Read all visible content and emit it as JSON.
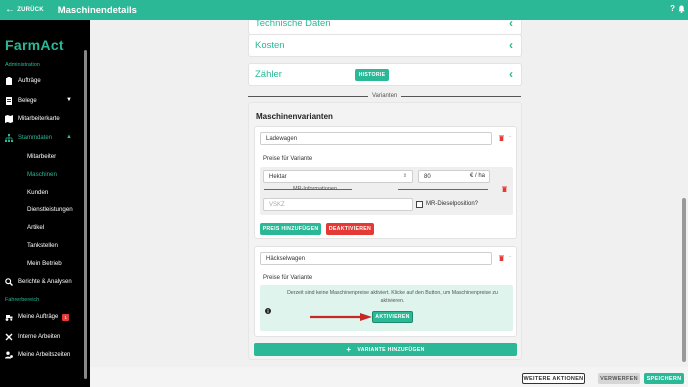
{
  "topbar": {
    "back_label": "ZURÜCK",
    "title": "Maschinendetails",
    "help": "?"
  },
  "sidebar": {
    "logo": "FarmAct",
    "section_admin": "Administration",
    "items": [
      {
        "label": "Aufträge"
      },
      {
        "label": "Belege"
      },
      {
        "label": "Mitarbeiterkarte"
      },
      {
        "label": "Stammdaten"
      }
    ],
    "sub_items": [
      {
        "label": "Mitarbeiter"
      },
      {
        "label": "Maschinen"
      },
      {
        "label": "Kunden"
      },
      {
        "label": "Dienstleistungen"
      },
      {
        "label": "Artikel"
      },
      {
        "label": "Tankstellen"
      },
      {
        "label": "Mein Betrieb"
      }
    ],
    "reports": "Berichte & Analysen",
    "section_driver": "Fahrerbereich",
    "driver_items": [
      {
        "label": "Meine Aufträge",
        "badge": "1"
      },
      {
        "label": "Interne Arbeiten"
      },
      {
        "label": "Meine Arbeitszeiten"
      }
    ]
  },
  "sections": {
    "tech": "Technische Daten",
    "kosten": "Kosten",
    "zaehler": "Zähler",
    "historie_button": "HISTORIE",
    "varianten_divider": "Varianten"
  },
  "varianten": {
    "title": "Maschinenvarianten",
    "variant1": {
      "name": "Ladewagen",
      "prices_label": "Preise für Variante",
      "unit_select": "Hektar",
      "price_value": "80",
      "price_unit": "€ / ha",
      "mr_divider": "MR-Informationen",
      "vskz_placeholder": "VSKZ",
      "mr_checkbox_label": "MR-Dieselposition?",
      "add_price_button": "PREIS HINZUFÜGEN",
      "deactivate_button": "DEAKTIVIEREN"
    },
    "variant2": {
      "name": "Häckselwagen",
      "prices_label": "Preise für Variante",
      "info_text": "Derzeit sind keine Maschinenpreise aktiviert. Klicke auf den Button, um Maschinenpreise zu aktivieren.",
      "activate_button": "AKTIVIEREN"
    },
    "add_variant_button": "VARIANTE HINZUFÜGEN"
  },
  "footer": {
    "more_actions": "WEITERE AKTIONEN",
    "discard": "VERWERFEN",
    "save": "SPEICHERN"
  },
  "colors": {
    "accent": "#2ab896",
    "danger": "#e53935",
    "sidebar": "#000000"
  }
}
